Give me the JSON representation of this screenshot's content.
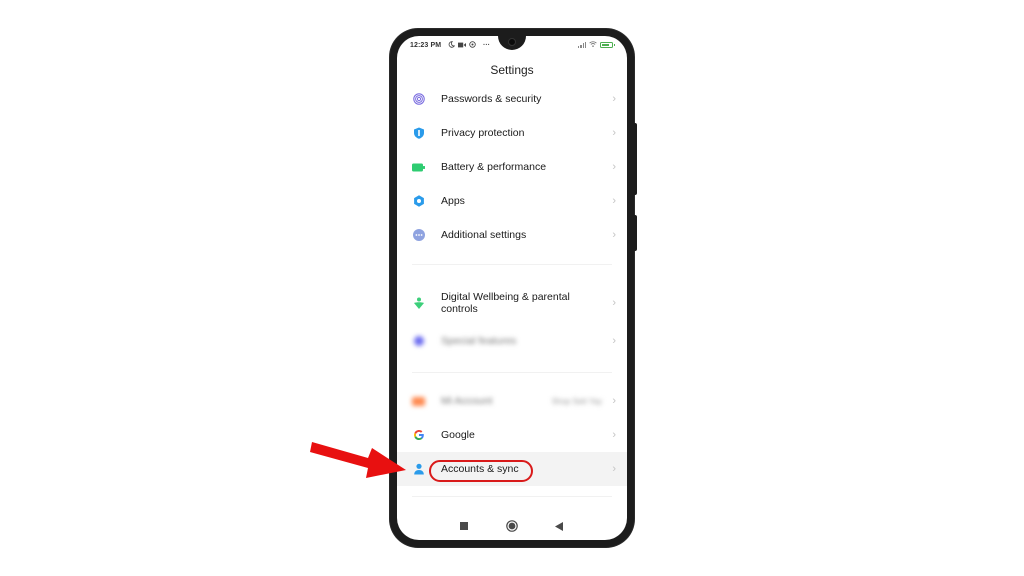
{
  "statusbar": {
    "time": "12:23 PM",
    "left_icons": [
      "moon-icon",
      "video-icon",
      "at-icon",
      "more-dots-icon"
    ],
    "more_dots": "···",
    "right_icons": [
      "signal-icon",
      "wifi-icon",
      "battery-icon"
    ]
  },
  "header": {
    "title": "Settings"
  },
  "settings": {
    "items": [
      {
        "label": "Passwords & security",
        "icon": "fingerprint-icon",
        "color": "#7c6fe0"
      },
      {
        "label": "Privacy protection",
        "icon": "shield-icon",
        "color": "#2a9bea"
      },
      {
        "label": "Battery & performance",
        "icon": "battery-icon",
        "color": "#2ecc71"
      },
      {
        "label": "Apps",
        "icon": "gear-icon",
        "color": "#2a9bea"
      },
      {
        "label": "Additional settings",
        "icon": "more-icon",
        "color": "#8fa3e0"
      },
      {
        "label": "Digital Wellbeing & parental controls",
        "icon": "wellbeing-icon",
        "color": "#3ccf7a"
      },
      {
        "label": "Special features",
        "icon": "special-features-icon",
        "color": "#6b6bf0",
        "blurred": true
      },
      {
        "label": "Mi Account",
        "icon": "mi-account-icon",
        "color": "#ff8a50",
        "value": "Shop Sett Yay",
        "blurred": true
      },
      {
        "label": "Google",
        "icon": "google-icon",
        "color": "#4285f4"
      },
      {
        "label": "Accounts & sync",
        "icon": "person-icon",
        "color": "#2a9bea",
        "highlighted": true
      }
    ],
    "chevron": "›"
  },
  "annotation": {
    "arrow_color": "#e81010",
    "ring_color": "#d91a1a",
    "target": "Accounts & sync"
  },
  "navbar": {
    "buttons": [
      "recents-button",
      "home-button",
      "back-button"
    ]
  }
}
